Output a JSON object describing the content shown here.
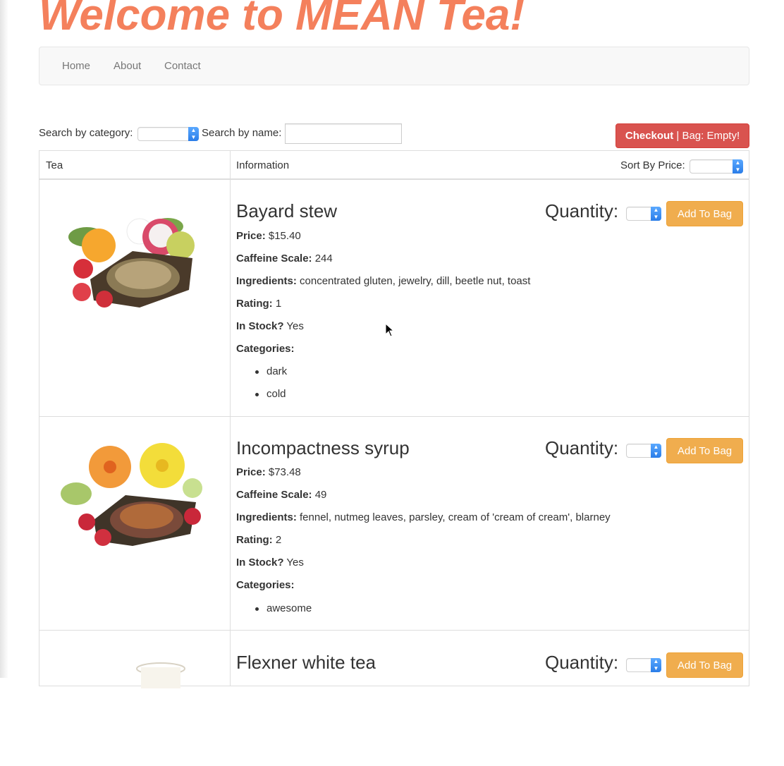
{
  "page": {
    "title": "Welcome to MEAN Tea!"
  },
  "nav": {
    "items": [
      {
        "label": "Home"
      },
      {
        "label": "About"
      },
      {
        "label": "Contact"
      }
    ]
  },
  "search": {
    "category_label": "Search by category:",
    "name_label": "Search by name:",
    "name_value": "",
    "category_value": ""
  },
  "checkout": {
    "label": "Checkout",
    "bag_text": "| Bag: Empty!"
  },
  "table": {
    "col_tea": "Tea",
    "col_info": "Information",
    "sort_label": "Sort By Price:",
    "sort_value": ""
  },
  "labels": {
    "quantity": "Quantity:",
    "add_to_bag": "Add To Bag",
    "price": "Price:",
    "caffeine": "Caffeine Scale:",
    "ingredients": "Ingredients:",
    "rating": "Rating:",
    "in_stock": "In Stock?",
    "categories": "Categories:"
  },
  "teas": [
    {
      "name": "Bayard stew",
      "price": "$15.40",
      "caffeine": "244",
      "ingredients": "concentrated gluten, jewelry, dill, beetle nut, toast",
      "rating": "1",
      "in_stock": "Yes",
      "categories": [
        "dark",
        "cold"
      ]
    },
    {
      "name": "Incompactness syrup",
      "price": "$73.48",
      "caffeine": "49",
      "ingredients": "fennel, nutmeg leaves, parsley, cream of 'cream of cream', blarney",
      "rating": "2",
      "in_stock": "Yes",
      "categories": [
        "awesome"
      ]
    },
    {
      "name": "Flexner white tea"
    }
  ],
  "colors": {
    "title": "#f4805c",
    "checkout": "#d9534f",
    "add_button": "#f0ad4e",
    "select_arrow": "#2a7de8"
  }
}
